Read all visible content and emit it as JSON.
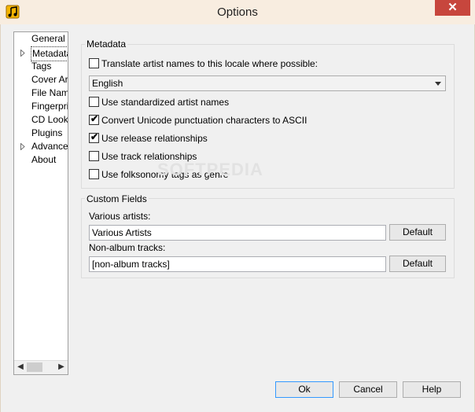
{
  "window": {
    "title": "Options",
    "close_glyph": "✕"
  },
  "sidebar": {
    "items": [
      {
        "label": "General",
        "expandable": false,
        "selected": false
      },
      {
        "label": "Metadata",
        "expandable": true,
        "selected": true
      },
      {
        "label": "Tags",
        "expandable": false,
        "selected": false
      },
      {
        "label": "Cover Art",
        "expandable": false,
        "selected": false
      },
      {
        "label": "File Naming",
        "expandable": false,
        "selected": false
      },
      {
        "label": "Fingerprinting",
        "expandable": false,
        "selected": false
      },
      {
        "label": "CD Lookup",
        "expandable": false,
        "selected": false
      },
      {
        "label": "Plugins",
        "expandable": false,
        "selected": false
      },
      {
        "label": "Advanced",
        "expandable": true,
        "selected": false
      },
      {
        "label": "About",
        "expandable": false,
        "selected": false
      }
    ]
  },
  "metadata": {
    "group_title": "Metadata",
    "translate": {
      "label": "Translate artist names to this locale where possible:",
      "checked": false
    },
    "locale": {
      "value": "English"
    },
    "standardized": {
      "label": "Use standardized artist names",
      "checked": false
    },
    "convert_unicode": {
      "label": "Convert Unicode punctuation characters to ASCII",
      "checked": true
    },
    "release_relationships": {
      "label": "Use release relationships",
      "checked": true
    },
    "track_relationships": {
      "label": "Use track relationships",
      "checked": false
    },
    "folksonomy": {
      "label": "Use folksonomy tags as genre",
      "checked": false
    }
  },
  "custom_fields": {
    "group_title": "Custom Fields",
    "various_artists": {
      "label": "Various artists:",
      "value": "Various Artists",
      "default_label": "Default"
    },
    "non_album": {
      "label": "Non-album tracks:",
      "value": "[non-album tracks]",
      "default_label": "Default"
    }
  },
  "footer": {
    "ok_label": "Ok",
    "cancel_label": "Cancel",
    "help_label": "Help"
  },
  "check_glyph": "✔",
  "watermark_text": "SOFTPEDIA"
}
